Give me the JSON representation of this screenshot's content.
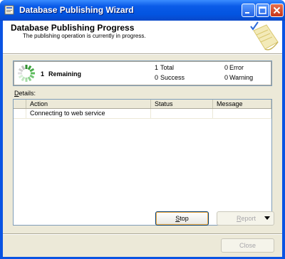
{
  "window": {
    "title": "Database Publishing Wizard"
  },
  "header": {
    "title": "Database Publishing Progress",
    "subtitle": "The publishing operation is currently in progress."
  },
  "summary": {
    "remaining_count": "1",
    "remaining_label": "Remaining",
    "total_count": "1",
    "total_label": "Total",
    "success_count": "0",
    "success_label": "Success",
    "error_count": "0",
    "error_label": "Error",
    "warning_count": "0",
    "warning_label": "Warning"
  },
  "details": {
    "label_mnemonic": "D",
    "label_rest": "etails:",
    "columns": [
      "Action",
      "Status",
      "Message"
    ],
    "rows": [
      {
        "action": "Connecting to web service",
        "status": "",
        "message": ""
      }
    ]
  },
  "buttons": {
    "stop_mnemonic": "S",
    "stop_rest": "top",
    "report_mnemonic": "R",
    "report_rest": "eport",
    "close": "Close"
  },
  "colors": {
    "titlebar": "#0a5be8",
    "dialog_bg": "#ece9d8",
    "button_border": "#003c74"
  },
  "icons": [
    "app-icon",
    "minimize-icon",
    "maximize-icon",
    "close-icon",
    "wizard-scroll-icon",
    "progress-spinner-icon",
    "dropdown-arrow-icon"
  ]
}
